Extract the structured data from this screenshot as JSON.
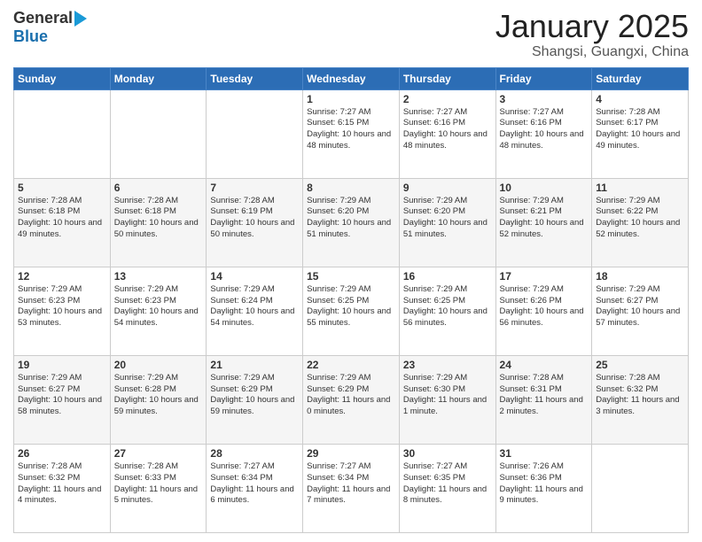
{
  "logo": {
    "general": "General",
    "blue": "Blue"
  },
  "title": {
    "month_year": "January 2025",
    "location": "Shangsi, Guangxi, China"
  },
  "days_of_week": [
    "Sunday",
    "Monday",
    "Tuesday",
    "Wednesday",
    "Thursday",
    "Friday",
    "Saturday"
  ],
  "weeks": [
    [
      {
        "day": "",
        "info": ""
      },
      {
        "day": "",
        "info": ""
      },
      {
        "day": "",
        "info": ""
      },
      {
        "day": "1",
        "info": "Sunrise: 7:27 AM\nSunset: 6:15 PM\nDaylight: 10 hours\nand 48 minutes."
      },
      {
        "day": "2",
        "info": "Sunrise: 7:27 AM\nSunset: 6:16 PM\nDaylight: 10 hours\nand 48 minutes."
      },
      {
        "day": "3",
        "info": "Sunrise: 7:27 AM\nSunset: 6:16 PM\nDaylight: 10 hours\nand 48 minutes."
      },
      {
        "day": "4",
        "info": "Sunrise: 7:28 AM\nSunset: 6:17 PM\nDaylight: 10 hours\nand 49 minutes."
      }
    ],
    [
      {
        "day": "5",
        "info": "Sunrise: 7:28 AM\nSunset: 6:18 PM\nDaylight: 10 hours\nand 49 minutes."
      },
      {
        "day": "6",
        "info": "Sunrise: 7:28 AM\nSunset: 6:18 PM\nDaylight: 10 hours\nand 50 minutes."
      },
      {
        "day": "7",
        "info": "Sunrise: 7:28 AM\nSunset: 6:19 PM\nDaylight: 10 hours\nand 50 minutes."
      },
      {
        "day": "8",
        "info": "Sunrise: 7:29 AM\nSunset: 6:20 PM\nDaylight: 10 hours\nand 51 minutes."
      },
      {
        "day": "9",
        "info": "Sunrise: 7:29 AM\nSunset: 6:20 PM\nDaylight: 10 hours\nand 51 minutes."
      },
      {
        "day": "10",
        "info": "Sunrise: 7:29 AM\nSunset: 6:21 PM\nDaylight: 10 hours\nand 52 minutes."
      },
      {
        "day": "11",
        "info": "Sunrise: 7:29 AM\nSunset: 6:22 PM\nDaylight: 10 hours\nand 52 minutes."
      }
    ],
    [
      {
        "day": "12",
        "info": "Sunrise: 7:29 AM\nSunset: 6:23 PM\nDaylight: 10 hours\nand 53 minutes."
      },
      {
        "day": "13",
        "info": "Sunrise: 7:29 AM\nSunset: 6:23 PM\nDaylight: 10 hours\nand 54 minutes."
      },
      {
        "day": "14",
        "info": "Sunrise: 7:29 AM\nSunset: 6:24 PM\nDaylight: 10 hours\nand 54 minutes."
      },
      {
        "day": "15",
        "info": "Sunrise: 7:29 AM\nSunset: 6:25 PM\nDaylight: 10 hours\nand 55 minutes."
      },
      {
        "day": "16",
        "info": "Sunrise: 7:29 AM\nSunset: 6:25 PM\nDaylight: 10 hours\nand 56 minutes."
      },
      {
        "day": "17",
        "info": "Sunrise: 7:29 AM\nSunset: 6:26 PM\nDaylight: 10 hours\nand 56 minutes."
      },
      {
        "day": "18",
        "info": "Sunrise: 7:29 AM\nSunset: 6:27 PM\nDaylight: 10 hours\nand 57 minutes."
      }
    ],
    [
      {
        "day": "19",
        "info": "Sunrise: 7:29 AM\nSunset: 6:27 PM\nDaylight: 10 hours\nand 58 minutes."
      },
      {
        "day": "20",
        "info": "Sunrise: 7:29 AM\nSunset: 6:28 PM\nDaylight: 10 hours\nand 59 minutes."
      },
      {
        "day": "21",
        "info": "Sunrise: 7:29 AM\nSunset: 6:29 PM\nDaylight: 10 hours\nand 59 minutes."
      },
      {
        "day": "22",
        "info": "Sunrise: 7:29 AM\nSunset: 6:29 PM\nDaylight: 11 hours\nand 0 minutes."
      },
      {
        "day": "23",
        "info": "Sunrise: 7:29 AM\nSunset: 6:30 PM\nDaylight: 11 hours\nand 1 minute."
      },
      {
        "day": "24",
        "info": "Sunrise: 7:28 AM\nSunset: 6:31 PM\nDaylight: 11 hours\nand 2 minutes."
      },
      {
        "day": "25",
        "info": "Sunrise: 7:28 AM\nSunset: 6:32 PM\nDaylight: 11 hours\nand 3 minutes."
      }
    ],
    [
      {
        "day": "26",
        "info": "Sunrise: 7:28 AM\nSunset: 6:32 PM\nDaylight: 11 hours\nand 4 minutes."
      },
      {
        "day": "27",
        "info": "Sunrise: 7:28 AM\nSunset: 6:33 PM\nDaylight: 11 hours\nand 5 minutes."
      },
      {
        "day": "28",
        "info": "Sunrise: 7:27 AM\nSunset: 6:34 PM\nDaylight: 11 hours\nand 6 minutes."
      },
      {
        "day": "29",
        "info": "Sunrise: 7:27 AM\nSunset: 6:34 PM\nDaylight: 11 hours\nand 7 minutes."
      },
      {
        "day": "30",
        "info": "Sunrise: 7:27 AM\nSunset: 6:35 PM\nDaylight: 11 hours\nand 8 minutes."
      },
      {
        "day": "31",
        "info": "Sunrise: 7:26 AM\nSunset: 6:36 PM\nDaylight: 11 hours\nand 9 minutes."
      },
      {
        "day": "",
        "info": ""
      }
    ]
  ]
}
